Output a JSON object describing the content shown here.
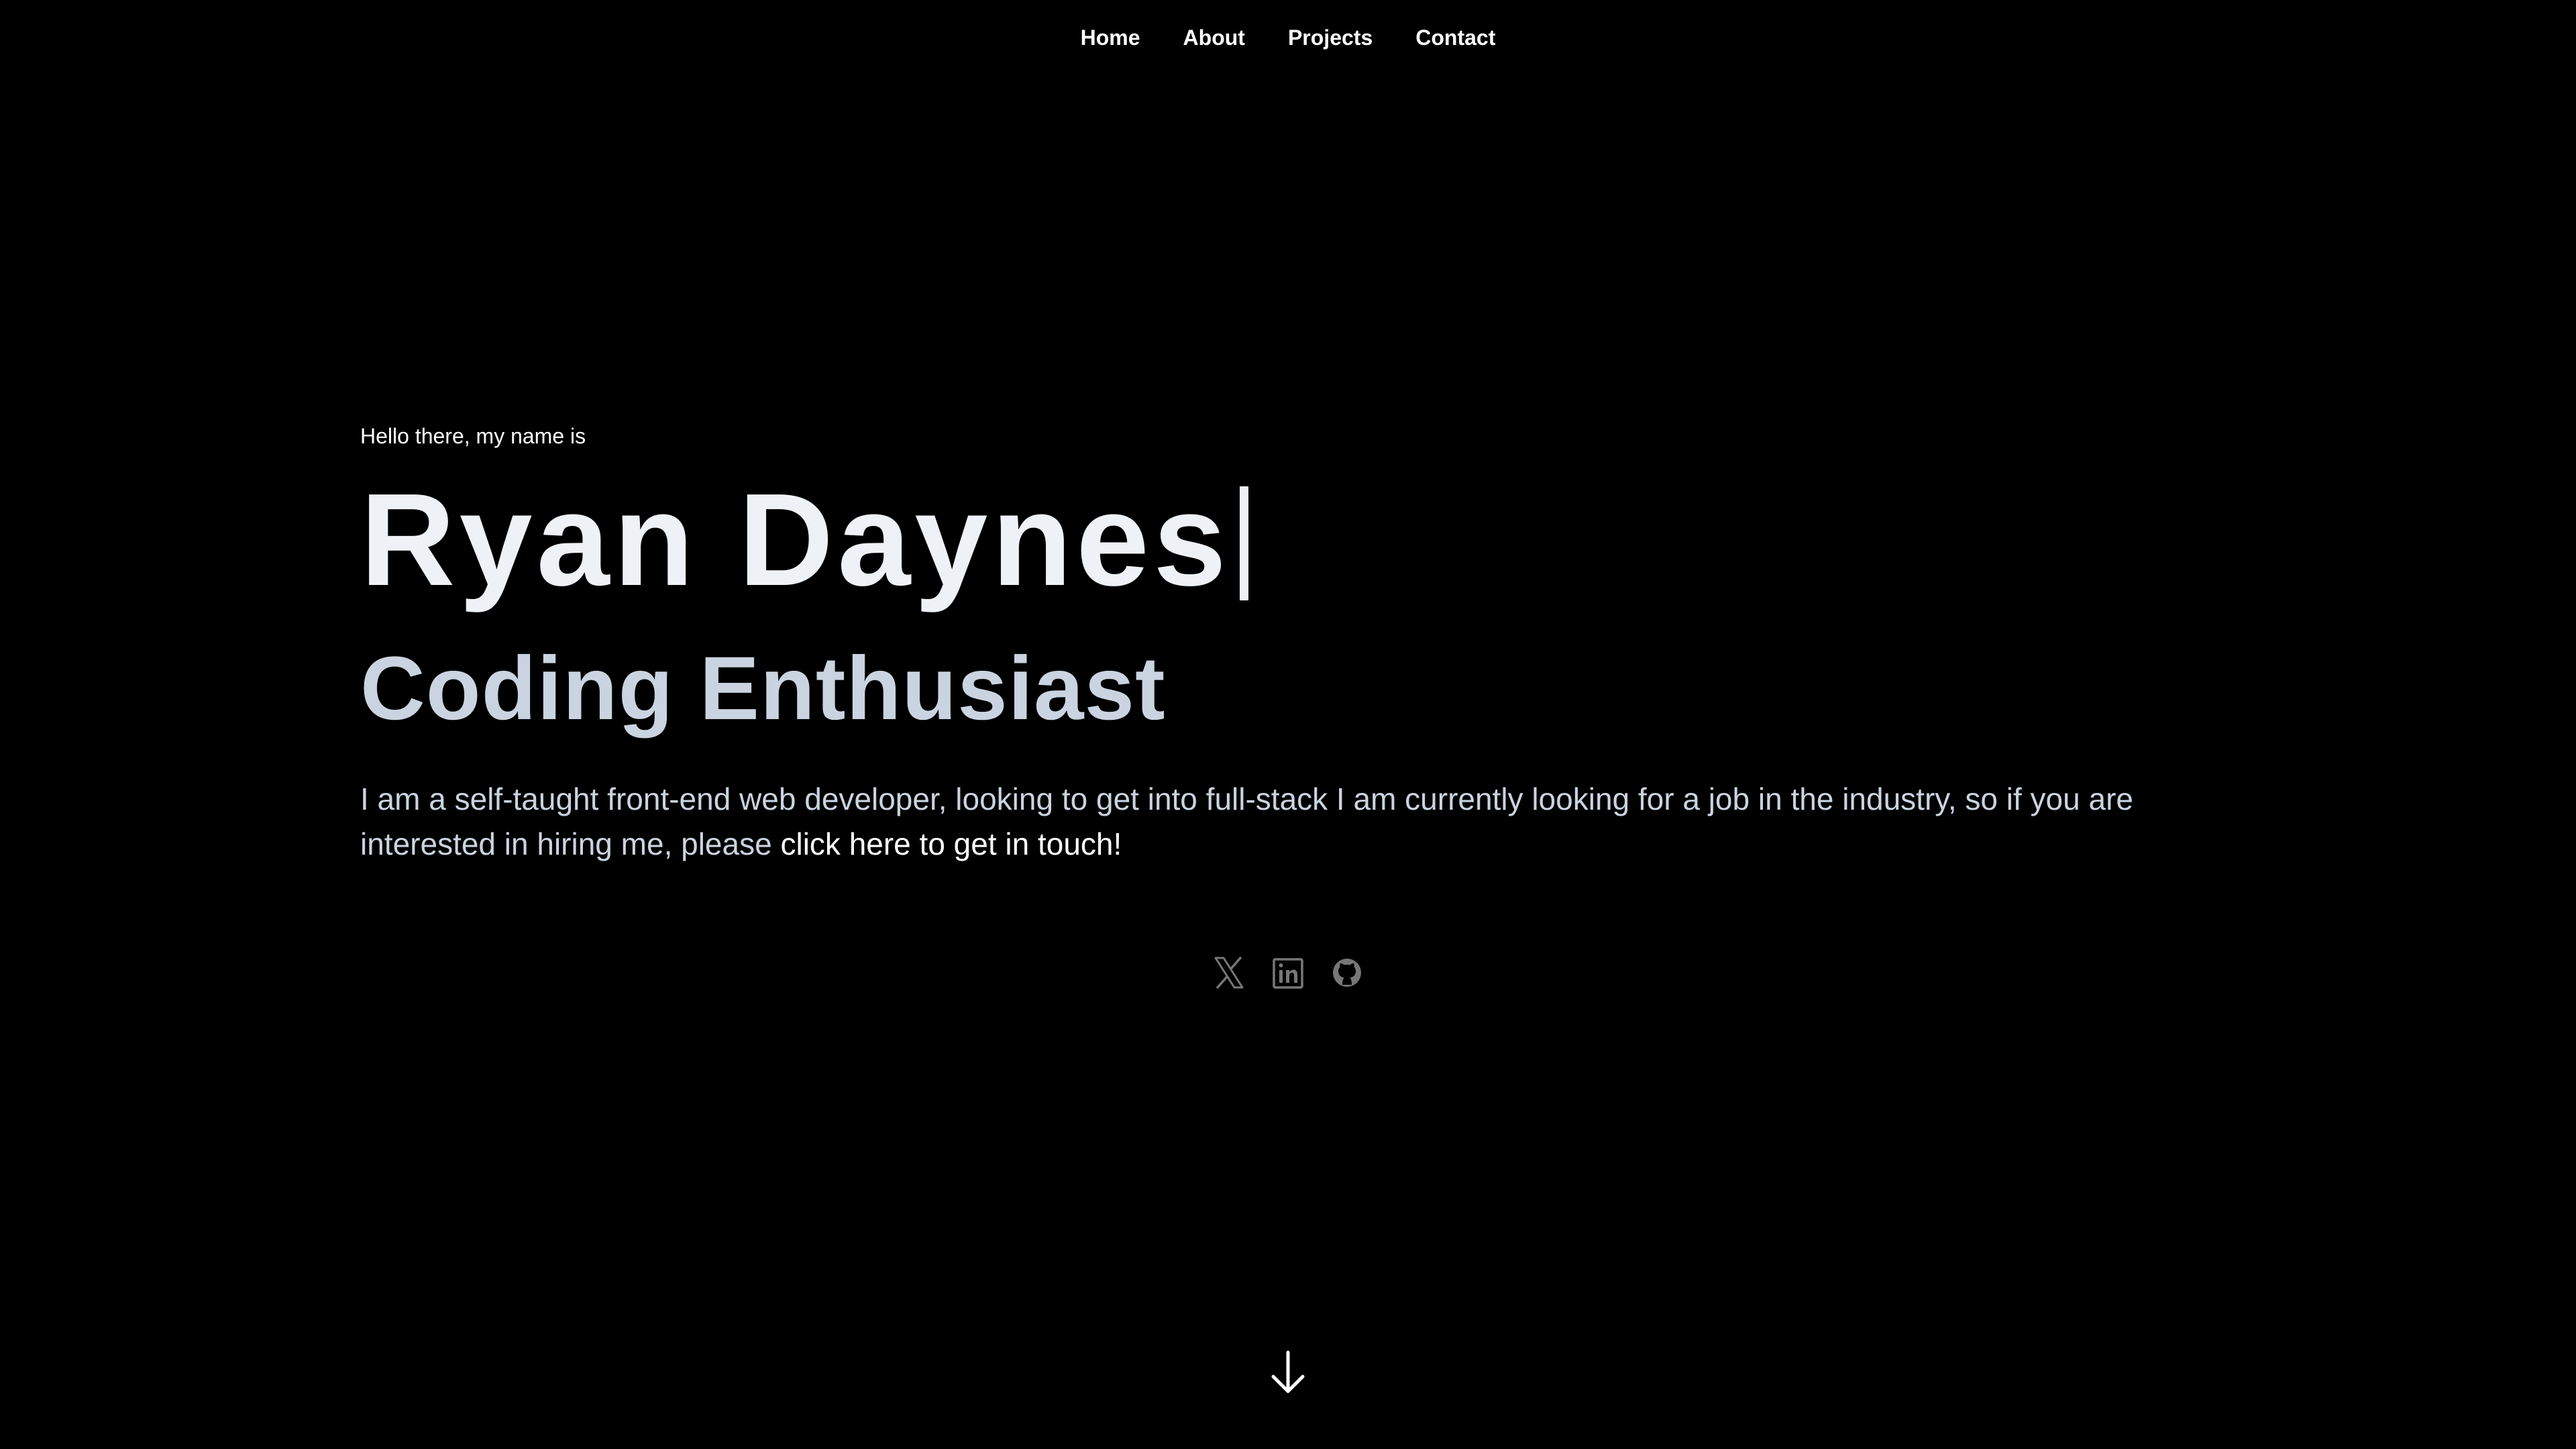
{
  "nav": {
    "items": [
      {
        "label": "Home"
      },
      {
        "label": "About"
      },
      {
        "label": "Projects"
      },
      {
        "label": "Contact"
      }
    ]
  },
  "hero": {
    "greeting": "Hello there, my name is",
    "name": "Ryan Daynes",
    "title": "Coding Enthusiast",
    "bio_text": "I am a self-taught front-end web developer, looking to get into full-stack I am currently looking for a job in the industry, so if you are interested in hiring me, please ",
    "cta_link": "click here to get in touch!"
  },
  "social": {
    "icons": [
      "x-twitter-icon",
      "linkedin-icon",
      "github-icon"
    ],
    "icon_color": "#777777"
  },
  "scroll": {
    "icon": "arrow-down-icon"
  },
  "colors": {
    "background": "#000000",
    "heading": "#eef1f6",
    "subheading": "#cad4e0",
    "link": "#ffffff"
  }
}
